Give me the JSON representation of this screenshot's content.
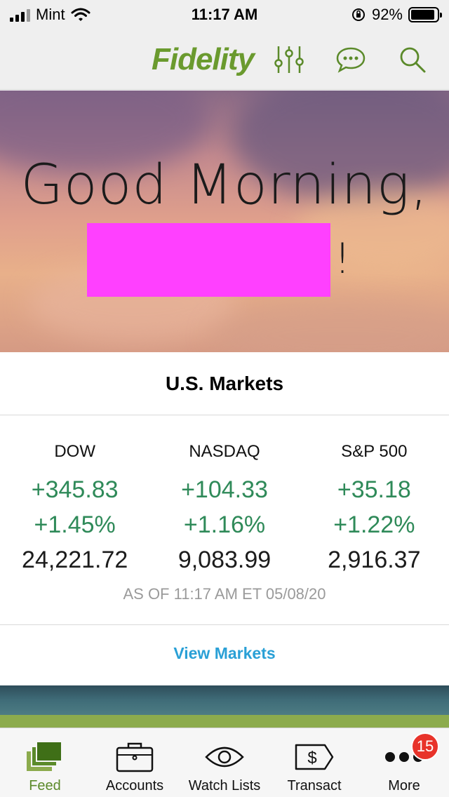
{
  "status_bar": {
    "carrier": "Mint",
    "time": "11:17 AM",
    "battery": "92%",
    "battery_level": 0.92
  },
  "header": {
    "logo": "Fidelity"
  },
  "hero": {
    "greeting": "Good Morning,",
    "punctuation": "!"
  },
  "markets": {
    "title": "U.S. Markets",
    "indices": [
      {
        "name": "DOW",
        "change": "+345.83",
        "percent": "+1.45%",
        "value": "24,221.72"
      },
      {
        "name": "NASDAQ",
        "change": "+104.33",
        "percent": "+1.16%",
        "value": "9,083.99"
      },
      {
        "name": "S&P 500",
        "change": "+35.18",
        "percent": "+1.22%",
        "value": "2,916.37"
      }
    ],
    "as_of": "AS OF 11:17 AM ET 05/08/20",
    "view_link": "View Markets"
  },
  "colors": {
    "brand_green": "#6a9a2e",
    "gain_green": "#2f8a59",
    "link_blue": "#2aa0d6",
    "badge_red": "#e8332a"
  },
  "tabs": [
    {
      "label": "Feed",
      "icon": "feed-icon",
      "active": true
    },
    {
      "label": "Accounts",
      "icon": "briefcase-icon"
    },
    {
      "label": "Watch Lists",
      "icon": "eye-icon"
    },
    {
      "label": "Transact",
      "icon": "dollar-tag-icon"
    },
    {
      "label": "More",
      "icon": "more-dots-icon",
      "badge": "15"
    }
  ]
}
